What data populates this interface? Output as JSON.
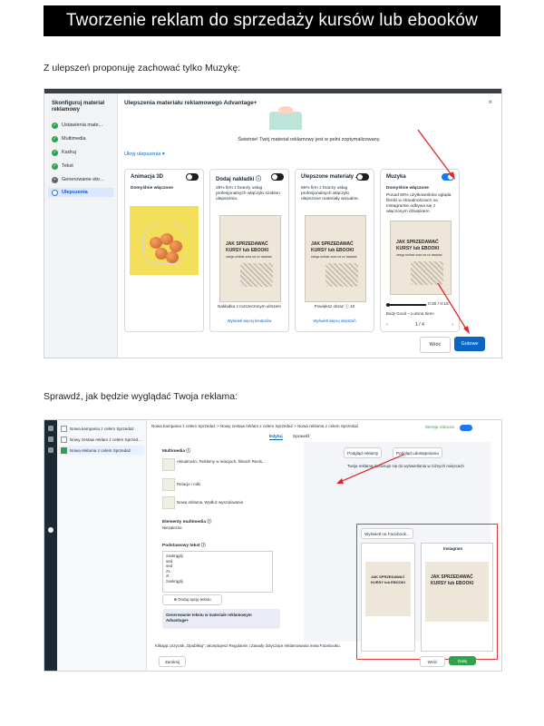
{
  "header": {
    "title": "Tworzenie reklam do sprzedaży kursów lub ebooków"
  },
  "para1": "Z ulepszeń proponuję zachować tylko Muzykę:",
  "para2": "Sprawdź, jak będzie wyglądać Twoja reklama:",
  "shot1": {
    "sidebar_title": "Skonfiguruj materiał reklamowy",
    "steps": [
      {
        "label": "Ustawienia mate..."
      },
      {
        "label": "Multimedia"
      },
      {
        "label": "Kadruj"
      },
      {
        "label": "Tekst"
      },
      {
        "label": "Generowanie ebr..."
      },
      {
        "label": "Ulepszenia"
      }
    ],
    "heading": "Ulepszenia materiału reklamowego Advantage+",
    "close": "×",
    "success": "Świetnie! Twój materiał reklamowy jest w pełni zoptymalizowany.",
    "hide_link": "Ukryj ulepszenia ▾",
    "cards": [
      {
        "title": "Animacja 3D",
        "sub": "Domyślnie włączone",
        "foot": "",
        "link": ""
      },
      {
        "title": "Dodaj nakładki ⓘ",
        "sub": "25% firm z branży usług profesjonalnych włączyło szablon ulepszenia.",
        "foot": "Nakładka z rozszerzonym ulrszem",
        "link": "Wyświetl więcej kreatorów"
      },
      {
        "title": "Ulepszone materiały ...",
        "sub": "66% firm z branży usług profesjonalnych włączyło ulepszone materiały wizualne.",
        "foot": "Powiększ obraz ⓘ 10",
        "link": "Wyświetl więcej ulepszeń"
      },
      {
        "title": "Muzyka",
        "sub": "Domyślnie włączone",
        "extra": "Ponad 60% użytkowników ogląda filmiki w Aktualnościach na Instagramie odbywa się z włączonym dźwiękiem.",
        "time": "0:30 / 0:15",
        "artist": "Body Good – Lumina Siren",
        "pager": "1 / 4",
        "foot": "",
        "link": ""
      }
    ],
    "phone_text": {
      "line1": "JAK SPRZEDAWAĆ",
      "line2": "KURSY lub EBOOKI",
      "small": "czego unikać oraz na co uważać"
    },
    "btn_back": "Wróć",
    "btn_done": "Gotowe"
  },
  "shot2": {
    "tree": [
      {
        "label": "Nowa kampania z celem Sprzedaż"
      },
      {
        "label": "Nowy zestaw reklam z celem Sprzed..."
      },
      {
        "label": "Nowa reklama z celem Sprzedaż"
      }
    ],
    "breadcrumb": "Nowa kampania z celem Sprzedaż  >  Nowy zestaw reklam z celem Sprzedaż  >  Nowa reklama z celem Sprzedaż",
    "tab_edit": "Edytuj",
    "tab_review": "Sprawdź",
    "published": "Wersja robocza",
    "form": {
      "media_label": "Multimedia ⓘ",
      "media_item1": "Aktualności, Reklamy w relacjach, filmach Reels...",
      "media_item2": "Relacje i rolki",
      "media_item3": "Nowa reklama. Wydłuż wyszukiwania",
      "extras_label": "Elementy multimedia ⓘ",
      "extras_value": "Niezależne",
      "text_label": "Podstawowy tekst ⓘ",
      "text_lines": "zaokrąglij\\nsed\\nsed\\nzs\\nzt\\nzaokrąglij",
      "add_option": "⊕ Dodaj opcję tekstu",
      "callout": "Generowanie tekstu w materiale reklamowym Advantage+"
    },
    "preview": {
      "btn_preview": "Podgląd reklamy",
      "btn_share": "Podgląd udostępniania",
      "note": "Twoja reklama dostosuje się do wyświetlania w różnych miejscach",
      "view_label": "Wyświetl na Facebook...",
      "stories": "Instagram"
    },
    "legal": "Klikając przycisk „Opublikuj”, akceptujesz Regulamin i Zasady dotyczące reklamowania meta Facebooku.",
    "btn_close": "Zamknij",
    "btn_back": "Wróć",
    "btn_next": "Dalej"
  }
}
